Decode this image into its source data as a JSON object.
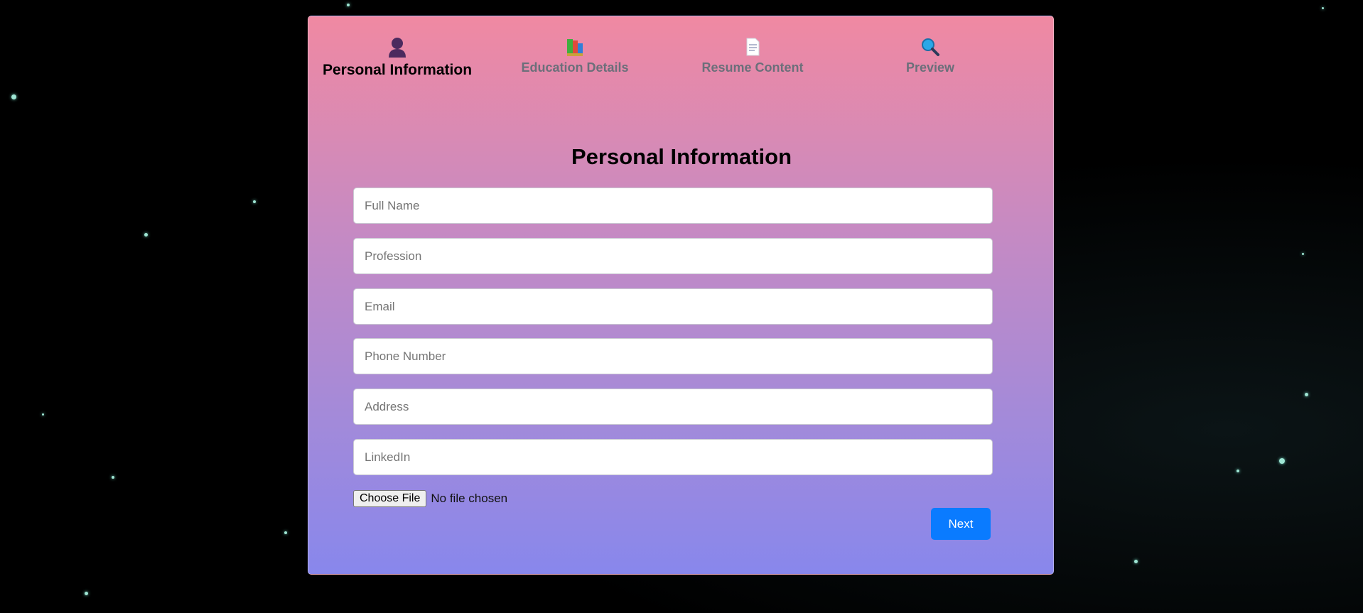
{
  "steps": [
    {
      "label": "Personal Information",
      "icon": "person-icon",
      "active": true
    },
    {
      "label": "Education Details",
      "icon": "books-icon",
      "active": false
    },
    {
      "label": "Resume Content",
      "icon": "document-icon",
      "active": false
    },
    {
      "label": "Preview",
      "icon": "magnifier-icon",
      "active": false
    }
  ],
  "form": {
    "title": "Personal Information",
    "fields": {
      "full_name": {
        "placeholder": "Full Name",
        "value": ""
      },
      "profession": {
        "placeholder": "Profession",
        "value": ""
      },
      "email": {
        "placeholder": "Email",
        "value": ""
      },
      "phone": {
        "placeholder": "Phone Number",
        "value": ""
      },
      "address": {
        "placeholder": "Address",
        "value": ""
      },
      "linkedin": {
        "placeholder": "LinkedIn",
        "value": ""
      }
    },
    "file": {
      "button_label": "Choose File",
      "status": "No file chosen"
    },
    "next_label": "Next"
  },
  "colors": {
    "gradient_top": "#f089a2",
    "gradient_bottom": "#8887ec",
    "accent": "#0a7bff"
  }
}
